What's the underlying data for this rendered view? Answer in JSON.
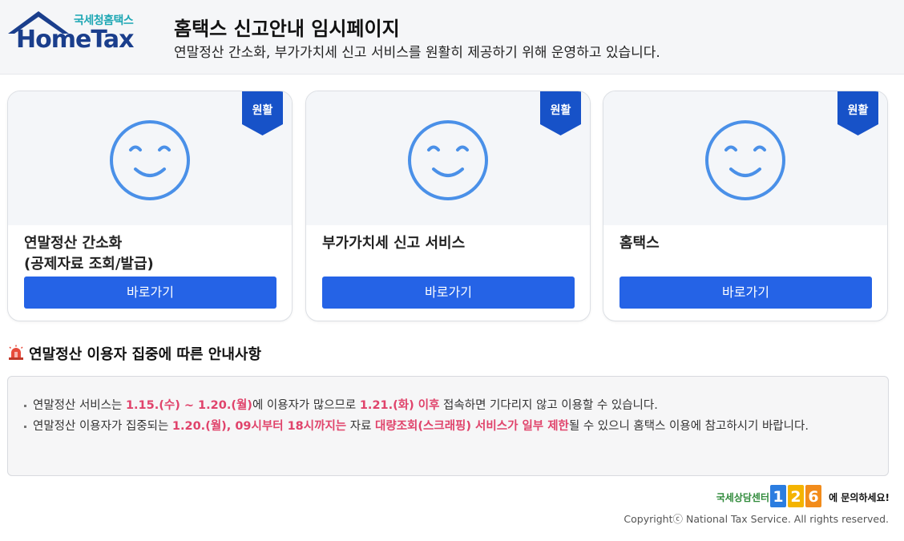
{
  "header": {
    "logo_kr": "국세청홈택스",
    "logo_en": "HomeTax",
    "title": "홈택스 신고안내 임시페이지",
    "subtitle": "연말정산 간소화, 부가가치세 신고 서비스를 원활히 제공하기 위해 운영하고 있습니다."
  },
  "cards": [
    {
      "status": "원활",
      "title_line1": "연말정산 간소화",
      "title_line2": "(공제자료 조회/발급)",
      "button": "바로가기"
    },
    {
      "status": "원활",
      "title_line1": "부가가치세 신고 서비스",
      "title_line2": "",
      "button": "바로가기"
    },
    {
      "status": "원활",
      "title_line1": "홈택스",
      "title_line2": "",
      "button": "바로가기"
    }
  ],
  "notice": {
    "heading": "연말정산 이용자 집중에 따른 안내사항",
    "item1": {
      "t1": "연말정산 서비스는 ",
      "h1": "1.15.(수) ~ 1.20.(월)",
      "t2": "에 이용자가 많으므로 ",
      "h2": "1.21.(화) 이후",
      "t3": " 접속하면 기다리지 않고 이용할 수 있습니다."
    },
    "item2": {
      "t1": "연말정산 이용자가 집중되는 ",
      "h1": "1.20.(월), 09시부터 18시까지는",
      "t2": " 자료 ",
      "h2": "대량조회(스크래핑) 서비스가 일부 제한",
      "t3": "될 수 있으니 홈택스 이용에 참고하시기 바랍니다."
    }
  },
  "footer": {
    "cs_prefix": "국세상담센터",
    "cs_number": "126",
    "cs_suffix": "에 문의하세요!",
    "copyright": "Copyrightⓒ National Tax Service. All rights reserved."
  },
  "colors": {
    "accent": "#2563e6",
    "highlight": "#e0436b",
    "ribbon": "#1752c8",
    "face": "#4a90e8"
  }
}
